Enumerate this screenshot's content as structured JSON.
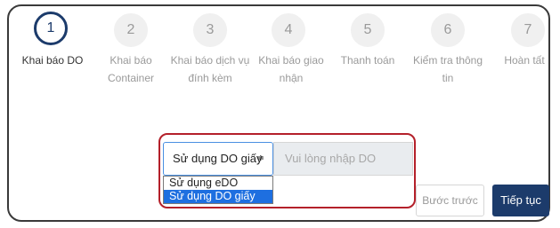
{
  "steps": [
    {
      "number": "1",
      "label_line1": "Khai báo DO",
      "label_line2": ""
    },
    {
      "number": "2",
      "label_line1": "Khai báo",
      "label_line2": "Container"
    },
    {
      "number": "3",
      "label_line1": "Khai báo dịch vụ",
      "label_line2": "đính kèm"
    },
    {
      "number": "4",
      "label_line1": "Khai báo giao",
      "label_line2": "nhận"
    },
    {
      "number": "5",
      "label_line1": "Thanh toán",
      "label_line2": ""
    },
    {
      "number": "6",
      "label_line1": "Kiểm tra thông",
      "label_line2": "tin"
    },
    {
      "number": "7",
      "label_line1": "Hoàn tất",
      "label_line2": ""
    }
  ],
  "active_step": "1",
  "do_form": {
    "select_value": "Sử dụng DO giấy",
    "select_arrow": "≑",
    "input_placeholder": "Vui lòng nhập DO",
    "options": [
      "Sử dụng eDO",
      "Sử dụng DO giấy"
    ],
    "selected_option": "Sử dụng DO giấy"
  },
  "buttons": {
    "back_label": "Bước trước",
    "next_label": "Tiếp tục"
  },
  "colors": {
    "primary": "#1c3b6b",
    "highlight": "#b4202a",
    "option_selected": "#1e6fe0"
  }
}
